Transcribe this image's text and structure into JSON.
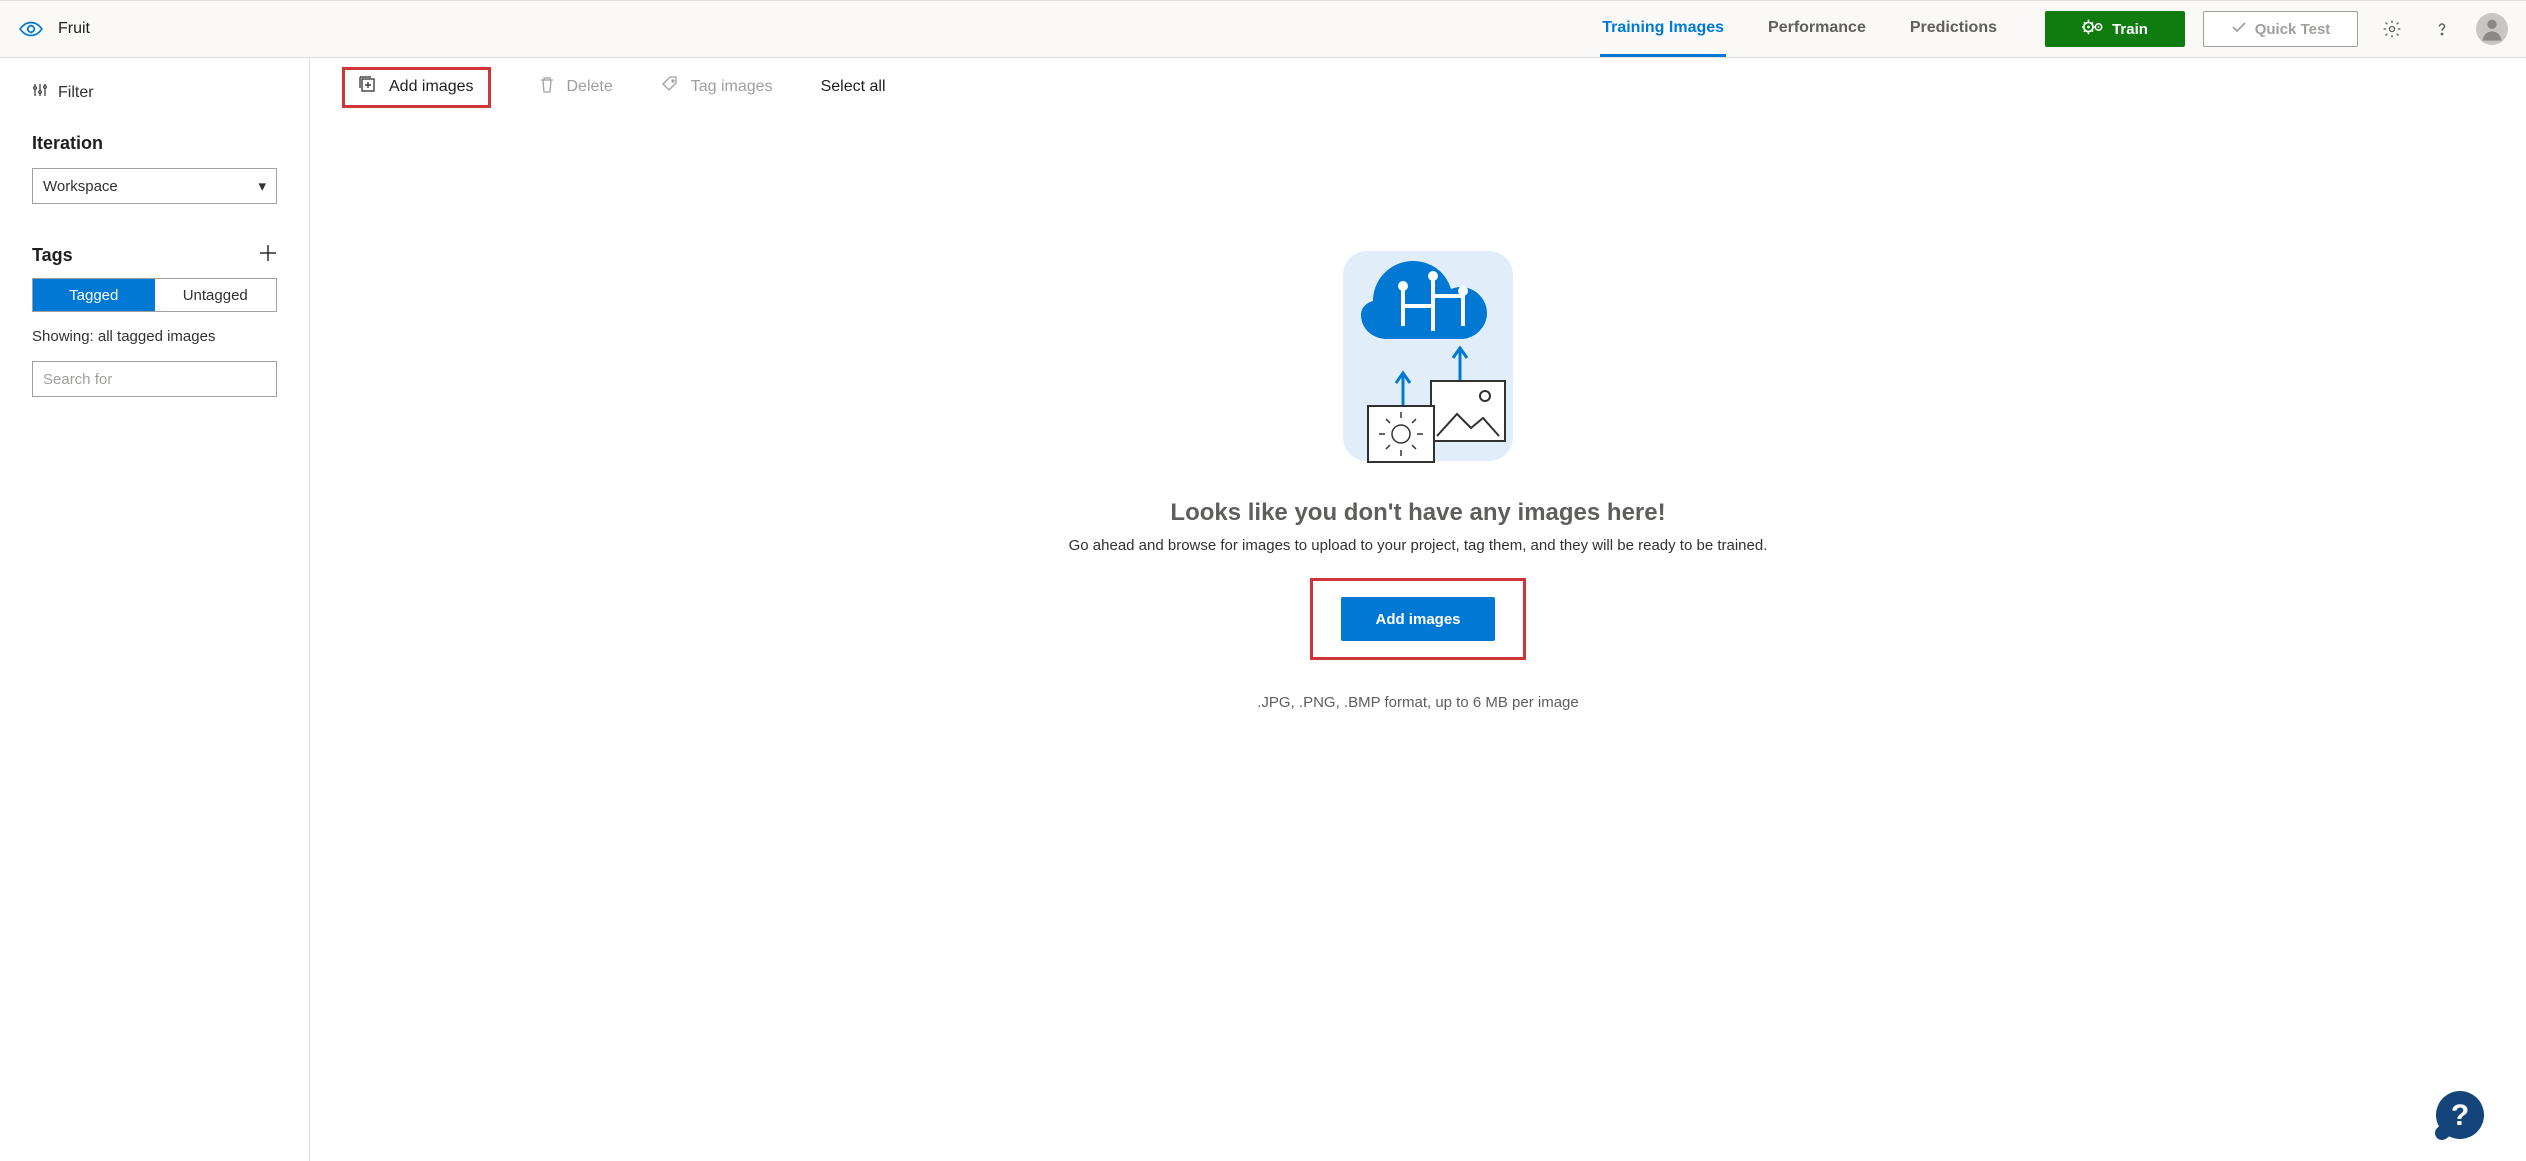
{
  "project_name": "Fruit",
  "nav": {
    "tabs": [
      "Training Images",
      "Performance",
      "Predictions"
    ],
    "active_index": 0
  },
  "header": {
    "train_label": "Train",
    "quick_test_label": "Quick Test"
  },
  "sidebar": {
    "filter_label": "Filter",
    "iteration_title": "Iteration",
    "iteration_selected": "Workspace",
    "tags_title": "Tags",
    "toggle": {
      "tagged": "Tagged",
      "untagged": "Untagged",
      "active": "tagged"
    },
    "showing_text": "Showing: all tagged images",
    "search_placeholder": "Search for"
  },
  "toolbar": {
    "add_images": "Add images",
    "delete": "Delete",
    "tag_images": "Tag images",
    "select_all": "Select all"
  },
  "empty": {
    "title": "Looks like you don't have any images here!",
    "subtitle": "Go ahead and browse for images to upload to your project, tag them, and they will be ready to be trained.",
    "add_button": "Add images",
    "format_hint": ".JPG, .PNG, .BMP format, up to 6 MB per image"
  },
  "colors": {
    "primary": "#0078d4",
    "success": "#107c10",
    "danger_highlight": "#d13438"
  }
}
